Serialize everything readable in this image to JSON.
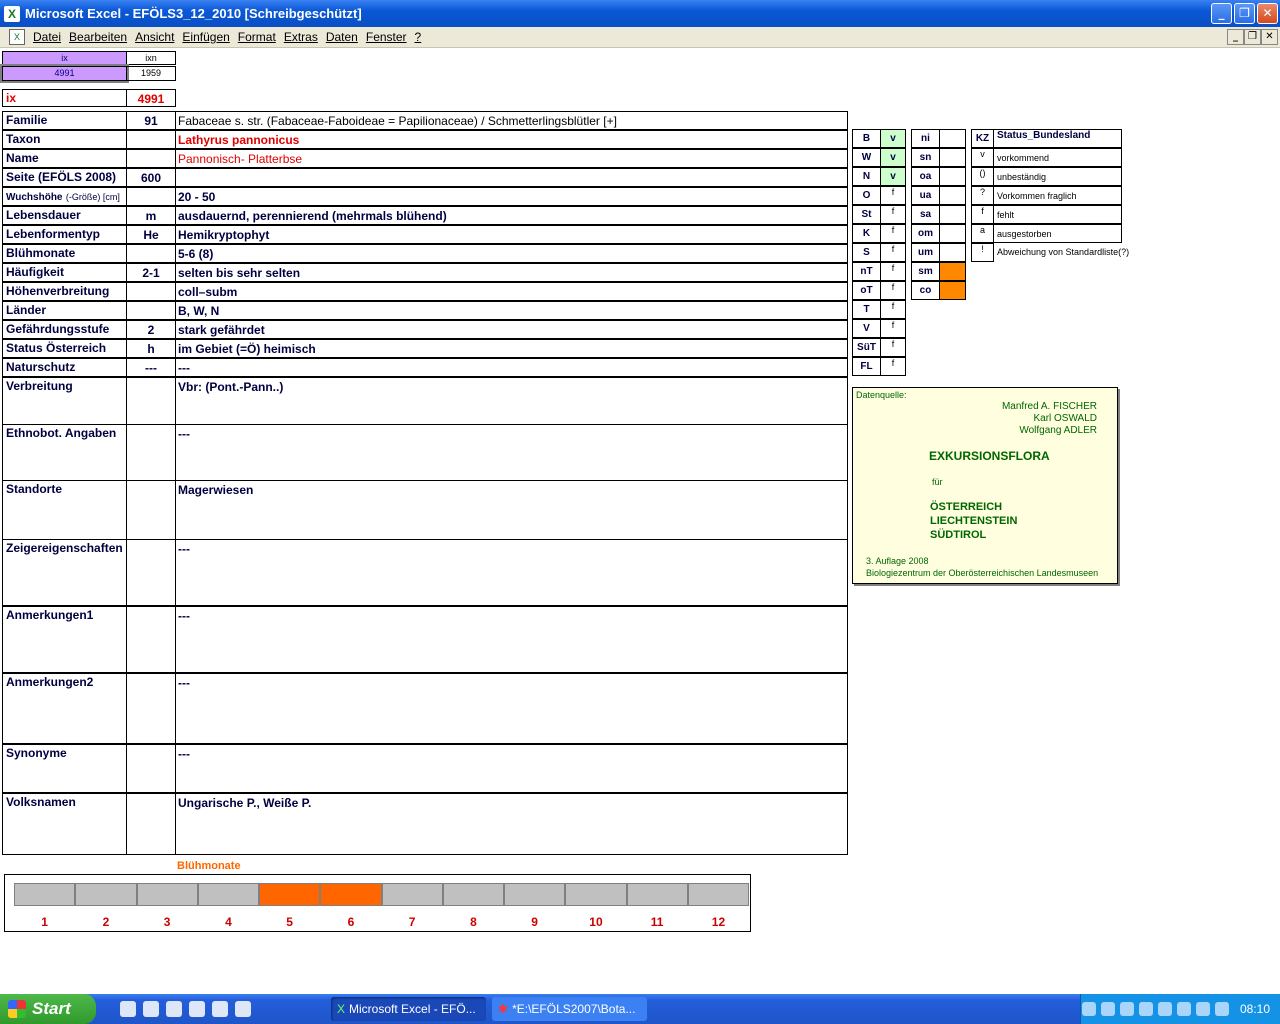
{
  "window": {
    "title": "Microsoft Excel - EFÖLS3_12_2010  [Schreibgeschützt]"
  },
  "menu": [
    "Datei",
    "Bearbeiten",
    "Ansicht",
    "Einfügen",
    "Format",
    "Extras",
    "Daten",
    "Fenster",
    "?"
  ],
  "top": {
    "ix_small_label": "ix",
    "ixn_label": "ixn",
    "ix_small_value": "4991",
    "ixn_value": "1959",
    "ix_label": "ix",
    "ix_value": "4991"
  },
  "rows": [
    {
      "label": "Familie",
      "num": "91",
      "value": "Fabaceae s. str. (Fabaceae-Faboideae = Papilionaceae)  /  Schmetterlingsblütler [+]"
    },
    {
      "label": "Taxon",
      "num": "",
      "value": "Lathyrus pannonicus"
    },
    {
      "label": "Name",
      "num": "",
      "value": "Pannonisch- Platterbse"
    },
    {
      "label": "Seite (EFÖLS 2008)",
      "num": "600",
      "value": ""
    },
    {
      "label": "Wuchshöhe",
      "label_small": "(-Größe) [cm]",
      "num": "",
      "value": "20 - 50"
    },
    {
      "label": "Lebensdauer",
      "num": "m",
      "value": "ausdauernd, perennierend (mehrmals blühend)"
    },
    {
      "label": "Lebenformentyp",
      "num": "He",
      "value": "Hemikryptophyt"
    },
    {
      "label": "Blühmonate",
      "num": "",
      "value": "5-6 (8)"
    },
    {
      "label": "Häufigkeit",
      "num": "2-1",
      "value": "selten bis sehr selten"
    },
    {
      "label": "Höhenverbreitung",
      "num": "",
      "value": "coll–subm"
    },
    {
      "label": "Länder",
      "num": "",
      "value": "B, W, N"
    },
    {
      "label": "Gefährdungsstufe",
      "num": "2",
      "value": "stark gefährdet"
    },
    {
      "label": "Status Österreich",
      "num": "h",
      "value": "im Gebiet (=Ö) heimisch"
    },
    {
      "label": "Naturschutz",
      "num": "---",
      "value": "---"
    }
  ],
  "tall_rows": [
    {
      "label": "Verbreitung",
      "value": "Vbr: (Pont.-Pann..)"
    },
    {
      "label": "Ethnobot. Angaben",
      "value": "---"
    },
    {
      "label": "Standorte",
      "value": "Magerwiesen"
    },
    {
      "label": "Zeigereigenschaften",
      "value": "---"
    },
    {
      "label": "Anmerkungen1",
      "value": "---"
    },
    {
      "label": "Anmerkungen2",
      "value": "---"
    },
    {
      "label": "Synonyme",
      "value": "---"
    },
    {
      "label": "Volksnamen",
      "value": "Ungarische P., Weiße P."
    }
  ],
  "bundesland": [
    {
      "code": "B",
      "status": "v"
    },
    {
      "code": "W",
      "status": "v"
    },
    {
      "code": "N",
      "status": "v"
    },
    {
      "code": "O",
      "status": "f"
    },
    {
      "code": "St",
      "status": "f"
    },
    {
      "code": "K",
      "status": "f"
    },
    {
      "code": "S",
      "status": "f"
    },
    {
      "code": "nT",
      "status": "f"
    },
    {
      "code": "oT",
      "status": "f"
    },
    {
      "code": "T",
      "status": "f"
    },
    {
      "code": "V",
      "status": "f"
    },
    {
      "code": "SüT",
      "status": "f"
    },
    {
      "code": "FL",
      "status": "f"
    }
  ],
  "hoehen": [
    {
      "code": "ni"
    },
    {
      "code": "sn"
    },
    {
      "code": "oa"
    },
    {
      "code": "ua"
    },
    {
      "code": "sa"
    },
    {
      "code": "om"
    },
    {
      "code": "um"
    },
    {
      "code": "sm",
      "active": true
    },
    {
      "code": "co",
      "active": true
    }
  ],
  "legend": {
    "kz_header": "KZ",
    "status_header": "Status_Bundesland",
    "items": [
      {
        "kz": "v",
        "text": "vorkommend"
      },
      {
        "kz": "()",
        "text": "unbeständig"
      },
      {
        "kz": "?",
        "text": "Vorkommen fraglich"
      },
      {
        "kz": "f",
        "text": "fehlt"
      },
      {
        "kz": "a",
        "text": "ausgestorben"
      },
      {
        "kz": "!",
        "text": "Abweichung von Standardliste(?)"
      }
    ]
  },
  "source": {
    "header": "Datenquelle:",
    "authors": [
      "Manfred A. FISCHER",
      "Karl OSWALD",
      "Wolfgang ADLER"
    ],
    "title": "EXKURSIONSFLORA",
    "fuer": "für",
    "countries": [
      "ÖSTERREICH",
      "LIECHTENSTEIN",
      "SÜDTIROL"
    ],
    "edition": "3. Auflage 2008",
    "publisher": "Biologiezentrum der Oberösterreichischen Landesmuseen"
  },
  "bloom_chart": {
    "title": "Blühmonate",
    "months": [
      "1",
      "2",
      "3",
      "4",
      "5",
      "6",
      "7",
      "8",
      "9",
      "10",
      "11",
      "12"
    ],
    "active": [
      5,
      6
    ]
  },
  "taskbar": {
    "start": "Start",
    "tasks": [
      "Microsoft Excel - EFÖ...",
      "*E:\\EFÖLS2007\\Bota..."
    ],
    "clock": "08:10"
  },
  "colors": {
    "active_month": "#ff6600",
    "inactive_month": "#c0c0c0",
    "check_green": "#ccffcc",
    "hoehen_active": "#ff8800",
    "source_bg": "#ffffe0"
  }
}
